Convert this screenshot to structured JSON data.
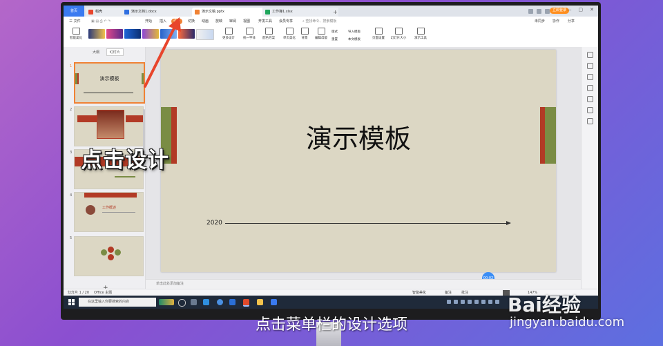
{
  "tabs": {
    "home": "首页",
    "doc": "稻壳",
    "word": "演示文档1.docx",
    "ppt": "演示文稿.pptx",
    "excel": "工作簿1.xlsx",
    "add": "+"
  },
  "header": {
    "sync_button": "立即登录",
    "window_controls": [
      "—",
      "▢",
      "✕"
    ]
  },
  "menu": {
    "file": "三 文件",
    "items": [
      "开始",
      "插入",
      "设计",
      "切换",
      "动画",
      "放映",
      "审阅",
      "视图",
      "开发工具",
      "会员专享"
    ],
    "active_index": 2,
    "search": "查找命令、搜索模板",
    "right": [
      "未同步",
      "协作",
      "分享"
    ]
  },
  "ribbon": {
    "smart_beautify": "智能美化",
    "more_design": "更多设计",
    "unify_font": "统一字体",
    "color_scheme": "配色方案",
    "beautify_layout": "单页美化",
    "background": "背景",
    "edit_master": "编辑母版",
    "format": "版式",
    "reset": "重置",
    "import_template": "导入模板",
    "this_template": "本文模板",
    "page_setup": "页面设置",
    "slide_size": "幻灯片大小",
    "presentation_tools": "演示工具"
  },
  "panel": {
    "tab_outline": "大纲",
    "tab_slides": "幻灯片",
    "slide_numbers": [
      "1",
      "2",
      "3",
      "4",
      "5"
    ],
    "thumb1_title": "演示模板",
    "thumb4_title": "工作概述",
    "add": "+"
  },
  "slide": {
    "title": "演示模板",
    "year": "2020"
  },
  "notes": {
    "placeholder": "单击此处添加备注"
  },
  "timer": "00:02",
  "status": {
    "slide_info": "幻灯片 1 / 20",
    "theme": "Office 主题",
    "smart": "智能美化",
    "notes": "备注",
    "comment": "批注",
    "zoom": "147%"
  },
  "taskbar": {
    "search_placeholder": "在这里输入你要搜索的内容"
  },
  "overlay": {
    "left_caption": "点击设计",
    "subtitle": "点击菜单栏的设计选项",
    "watermark_logo": "Bai经验",
    "watermark_url": "jingyan.baidu.com"
  },
  "colors": {
    "accent": "#f08234",
    "slide_bg": "#dcd7c4",
    "green_bar": "#7a8c44",
    "red_bar": "#b23a25",
    "arrow": "#e8452c"
  }
}
